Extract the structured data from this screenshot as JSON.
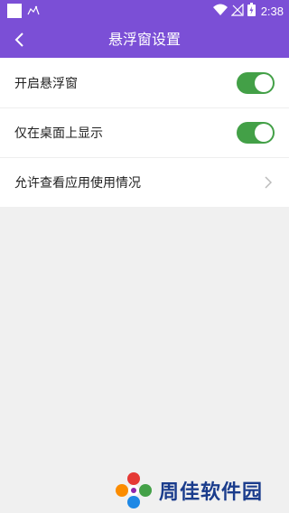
{
  "status_bar": {
    "time": "2:38"
  },
  "app_bar": {
    "title": "悬浮窗设置"
  },
  "settings": {
    "items": [
      {
        "label": "开启悬浮窗",
        "type": "toggle",
        "checked": true
      },
      {
        "label": "仅在桌面上显示",
        "type": "toggle",
        "checked": true
      },
      {
        "label": "允许查看应用使用情况",
        "type": "link"
      }
    ]
  },
  "watermark": {
    "text": "周佳软件园"
  },
  "colors": {
    "primary": "#7b4fd6",
    "toggle_on": "#43a047",
    "background": "#f0f0f0",
    "watermark_text": "#1a3c8c"
  }
}
